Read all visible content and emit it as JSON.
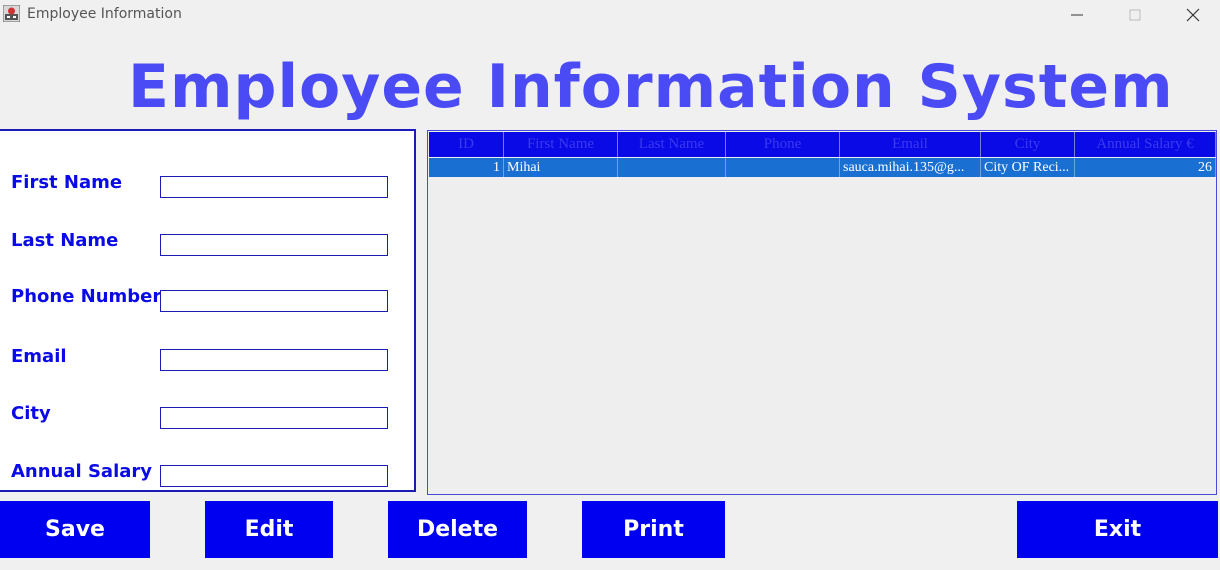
{
  "window": {
    "title": "Employee Information"
  },
  "heading": "Employee Information System",
  "form": {
    "first_name_label": "First Name",
    "last_name_label": "Last Name",
    "phone_label": "Phone Number",
    "email_label": "Email",
    "city_label": "City",
    "salary_label": "Annual Salary",
    "first_name_value": "",
    "last_name_value": "",
    "phone_value": "",
    "email_value": "",
    "city_value": "",
    "salary_value": ""
  },
  "table": {
    "columns": [
      "ID",
      "First Name",
      "Last Name",
      "Phone",
      "Email",
      "City",
      "Annual Salary €"
    ],
    "rows": [
      [
        "1",
        "Mihai",
        "",
        "",
        "sauca.mihai.135@g...",
        "City OF Reci...",
        "26"
      ]
    ]
  },
  "buttons": {
    "save": "Save",
    "edit": "Edit",
    "delete": "Delete",
    "print": "Print",
    "exit": "Exit"
  }
}
